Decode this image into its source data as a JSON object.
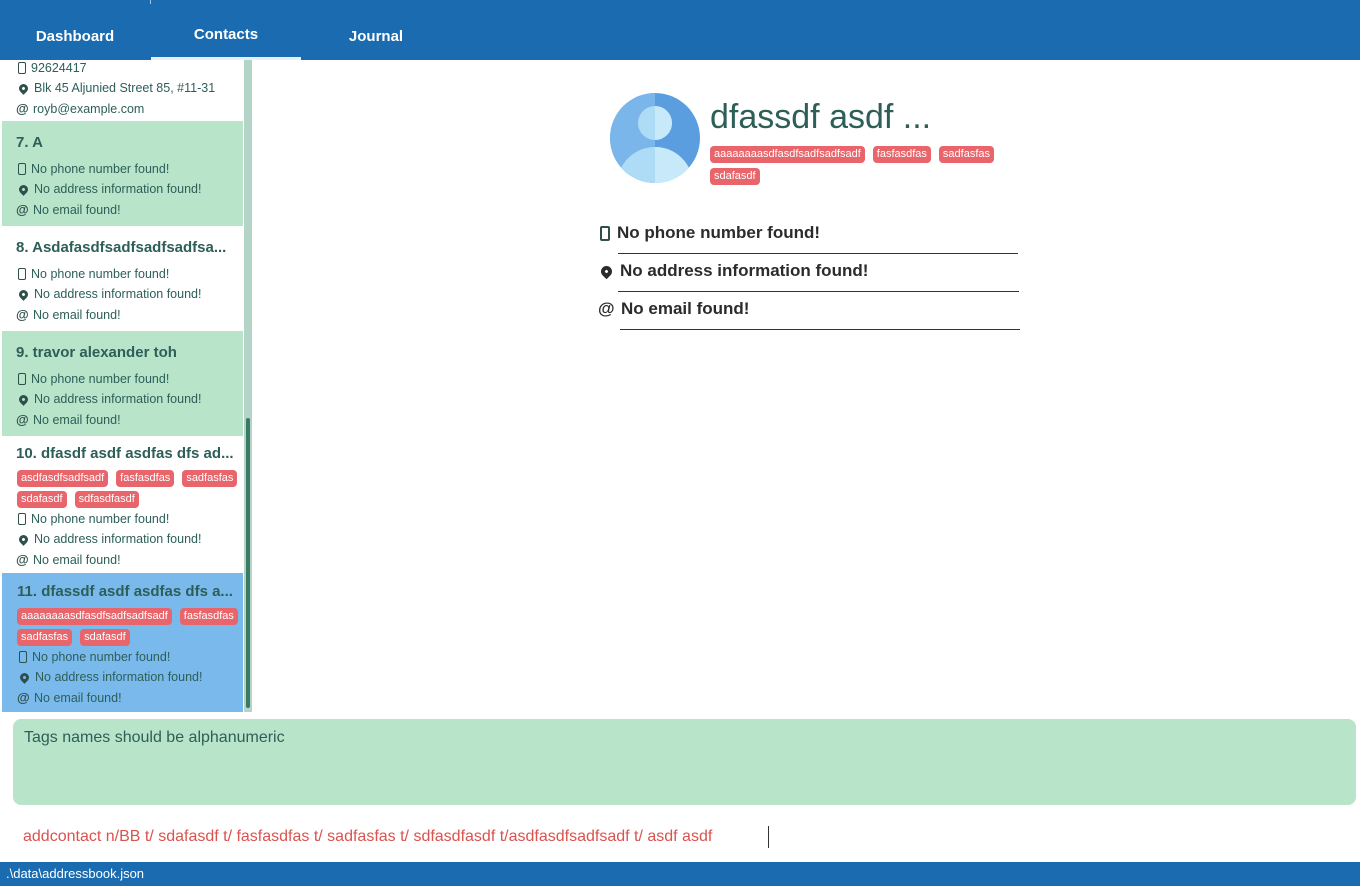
{
  "tabs": {
    "dashboard": "Dashboard",
    "contacts": "Contacts",
    "journal": "Journal"
  },
  "list": {
    "partial": {
      "phone": "92624417",
      "address": "Blk 45 Aljunied Street 85, #11-31",
      "email": "royb@example.com"
    },
    "cards": [
      {
        "title": "7.  A",
        "phone": "No phone number found!",
        "address": "No address information found!",
        "email": "No email found!"
      },
      {
        "title": "8.  Asdafasdfsadfsadfsadfsa...",
        "phone": "No phone number found!",
        "address": "No address information found!",
        "email": "No email found!"
      },
      {
        "title": "9.  travor alexander toh",
        "phone": "No phone number found!",
        "address": "No address information found!",
        "email": "No email found!"
      },
      {
        "title": "10.  dfasdf asdf asdfas dfs ad...",
        "tags_row1": [
          "asdfasdfsadfsadf",
          "fasfasdfas",
          "sadfasfas"
        ],
        "tags_row2": [
          "sdafasdf",
          "sdfasdfasdf"
        ],
        "phone": "No phone number found!",
        "address": "No address information found!",
        "email": "No email found!"
      },
      {
        "title": "11.  dfassdf asdf asdfas dfs a...",
        "tags_row1": [
          "aaaaaaaasdfasdfsadfsadfsadf",
          "fasfasdfas"
        ],
        "tags_row2": [
          "sadfasfas",
          "sdafasdf"
        ],
        "phone": "No phone number found!",
        "address": "No address information found!",
        "email": "No email found!"
      }
    ]
  },
  "detail": {
    "name": "dfassdf asdf ...",
    "tags": [
      "aaaaaaaasdfasdfsadfsadfsadf",
      "fasfasdfas",
      "sadfasfas",
      "sdafasdf"
    ],
    "phone": "No phone number found!",
    "address": "No address information found!",
    "email": "No email found!"
  },
  "result_message": "Tags names should be alphanumeric",
  "command_value": "addcontact n/BB t/ sdafasdf t/ fasfasdfas t/ sadfasfas t/ sdfasdfasdf t/asdfasdfsadfsadf t/ asdf asdf",
  "status_path": ".\\data\\addressbook.json",
  "colors": {
    "topbar": "#1a6bb0",
    "card_green": "#b8e4ca",
    "card_selected": "#7ab9ec",
    "tag": "#e8656b",
    "command_text": "#d9534f"
  }
}
